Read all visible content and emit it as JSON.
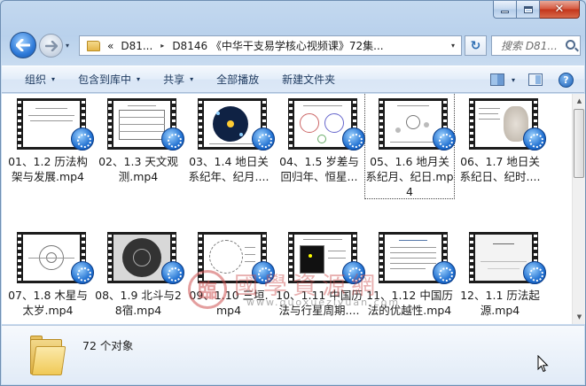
{
  "window": {
    "nav_dropdown_arrow": "▾",
    "address": {
      "overflow_chevron": "«",
      "segments": [
        "D81...",
        "D8146 《中华干支易学核心视频课》72集..."
      ],
      "separator": "▸",
      "dropdown": "▾"
    },
    "refresh_symbol": "↻",
    "search_placeholder": "搜索 D81...",
    "caption": {
      "close": "✕"
    }
  },
  "commandbar": {
    "organize": "组织",
    "include_library": "包含到库中",
    "share": "共享",
    "play_all": "全部播放",
    "new_folder": "新建文件夹",
    "menu_arrow": "▾",
    "help": "?"
  },
  "files": [
    {
      "name": "01、1.2 历法构架与发展.mp4"
    },
    {
      "name": "02、1.3 天文观测.mp4"
    },
    {
      "name": "03、1.4 地日关系纪年、纪月...."
    },
    {
      "name": "04、1.5 岁差与回归年、恒星..."
    },
    {
      "name": "05、1.6 地月关系纪月、纪日.mp4"
    },
    {
      "name": "06、1.7 地日关系纪日、纪时...."
    },
    {
      "name": "07、1.8 木星与太岁.mp4"
    },
    {
      "name": "08、1.9 北斗与28宿.mp4"
    },
    {
      "name": "09、1.10 三垣.mp4"
    },
    {
      "name": "10、1.11 中国历法与行星周期...."
    },
    {
      "name": "11、1.12 中国历法的优越性.mp4"
    },
    {
      "name": "12、1.1 历法起源.mp4"
    }
  ],
  "watermark": {
    "logo": "臨",
    "title": "國學資源網",
    "url": "www.guoxueziyuan.com"
  },
  "details": {
    "count": "72 个对象"
  },
  "colors": {
    "accent": "#1f6fd0",
    "chrome": "#c3d8ef"
  }
}
